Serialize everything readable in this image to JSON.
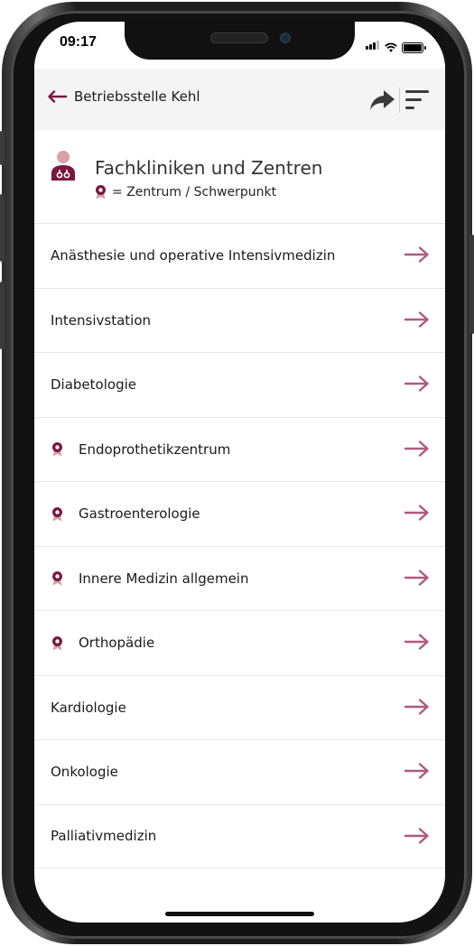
{
  "status_bar": {
    "time": "09:17"
  },
  "header": {
    "back_label": "Betriebsstelle Kehl"
  },
  "section": {
    "title": "Fachkliniken und Zentren",
    "legend_text": "= Zentrum / Schwerpunkt"
  },
  "list": {
    "items": [
      {
        "label": "Anästhesie und operative Intensivmedizin",
        "center": false
      },
      {
        "label": "Intensivstation",
        "center": false
      },
      {
        "label": "Diabetologie",
        "center": false
      },
      {
        "label": "Endoprothetikzentrum",
        "center": true
      },
      {
        "label": "Gastroenterologie",
        "center": true
      },
      {
        "label": "Innere Medizin allgemein",
        "center": true
      },
      {
        "label": "Orthopädie",
        "center": true
      },
      {
        "label": "Kardiologie",
        "center": false
      },
      {
        "label": "Onkologie",
        "center": false
      },
      {
        "label": "Palliativmedizin",
        "center": false
      }
    ]
  },
  "colors": {
    "accent": "#7b1840",
    "arrow": "#b05a7e",
    "icon_pink": "#d9a0a8",
    "header_bg": "#f4f4f4"
  },
  "icons": {
    "back": "arrow-left-icon",
    "share": "share-arrow-icon",
    "filter": "filter-lines-icon",
    "section": "doctor-icon",
    "badge": "award-ribbon-icon",
    "row_arrow": "arrow-right-icon"
  }
}
